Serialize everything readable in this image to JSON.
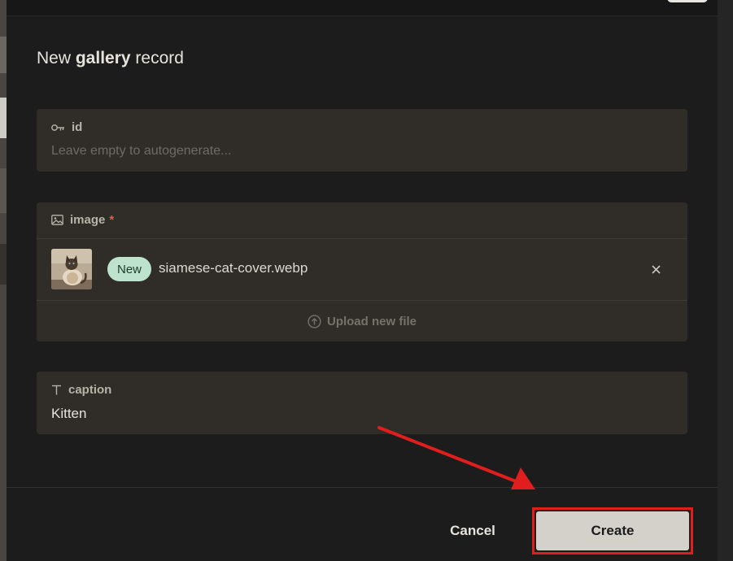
{
  "modal": {
    "title_prefix": "New ",
    "title_collection": "gallery",
    "title_suffix": " record"
  },
  "fields": {
    "id": {
      "label": "id",
      "icon": "key-icon",
      "value": "",
      "placeholder": "Leave empty to autogenerate..."
    },
    "image": {
      "label": "image",
      "required_mark": "*",
      "icon": "image-icon",
      "file": {
        "badge": "New",
        "name": "siamese-cat-cover.webp",
        "remove_icon": "close-icon"
      },
      "upload_label": "Upload new file",
      "upload_icon": "cloud-upload-icon"
    },
    "caption": {
      "label": "caption",
      "icon": "text-icon",
      "value": "Kitten"
    }
  },
  "footer": {
    "cancel_label": "Cancel",
    "create_label": "Create"
  },
  "colors": {
    "annotation": "#e01e1e",
    "badge_bg": "#bde3cf",
    "required": "#e05a4e"
  }
}
